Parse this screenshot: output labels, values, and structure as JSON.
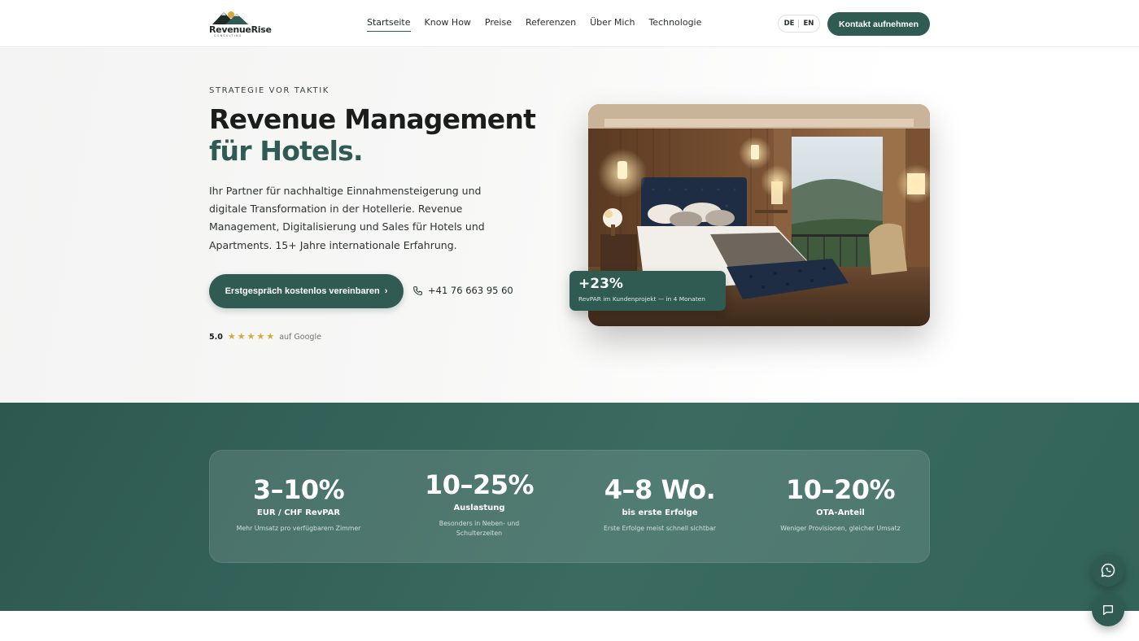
{
  "brand": {
    "name": "RevenueRise",
    "sub": "CONSULTING"
  },
  "nav": [
    {
      "label": "Startseite",
      "active": true
    },
    {
      "label": "Know How"
    },
    {
      "label": "Preise"
    },
    {
      "label": "Referenzen"
    },
    {
      "label": "Über Mich"
    },
    {
      "label": "Technologie"
    }
  ],
  "lang": {
    "de": "DE",
    "en": "EN",
    "current": "DE"
  },
  "header_cta": "Kontakt aufnehmen",
  "hero": {
    "eyebrow": "STRATEGIE VOR TAKTIK",
    "title_line1": "Revenue Management",
    "title_line2": "für Hotels.",
    "text": "Ihr Partner für nachhaltige Einnahmensteigerung und digitale Transformation in der Hotellerie. Revenue Management, Digitalisierung und Sales für Hotels und Apartments. 15+ Jahre internationale Erfahrung.",
    "cta": "Erstgespräch kostenlos vereinbaren",
    "cta_arrow": "›",
    "phone": "+41 76 663 95 60",
    "rating": {
      "score": "5.0",
      "stars": 5,
      "source": "auf Google"
    },
    "badge": {
      "value": "+23%",
      "label": "RevPAR im Kundenprojekt — in 4 Monaten"
    }
  },
  "stats": [
    {
      "value": "3–10%",
      "label": "EUR / CHF RevPAR",
      "note": "Mehr Umsatz pro verfügbarem Zimmer"
    },
    {
      "value": "10–25%",
      "label": "Auslastung",
      "note": "Besonders in Neben- und Schulterzeiten"
    },
    {
      "value": "4–8 Wo.",
      "label": "bis erste Erfolge",
      "note": "Erste Erfolge meist schnell sichtbar"
    },
    {
      "value": "10–20%",
      "label": "OTA-Anteil",
      "note": "Weniger Provisionen, gleicher Umsatz"
    }
  ],
  "colors": {
    "accent": "#2f5b52",
    "star": "#d8a73c"
  }
}
